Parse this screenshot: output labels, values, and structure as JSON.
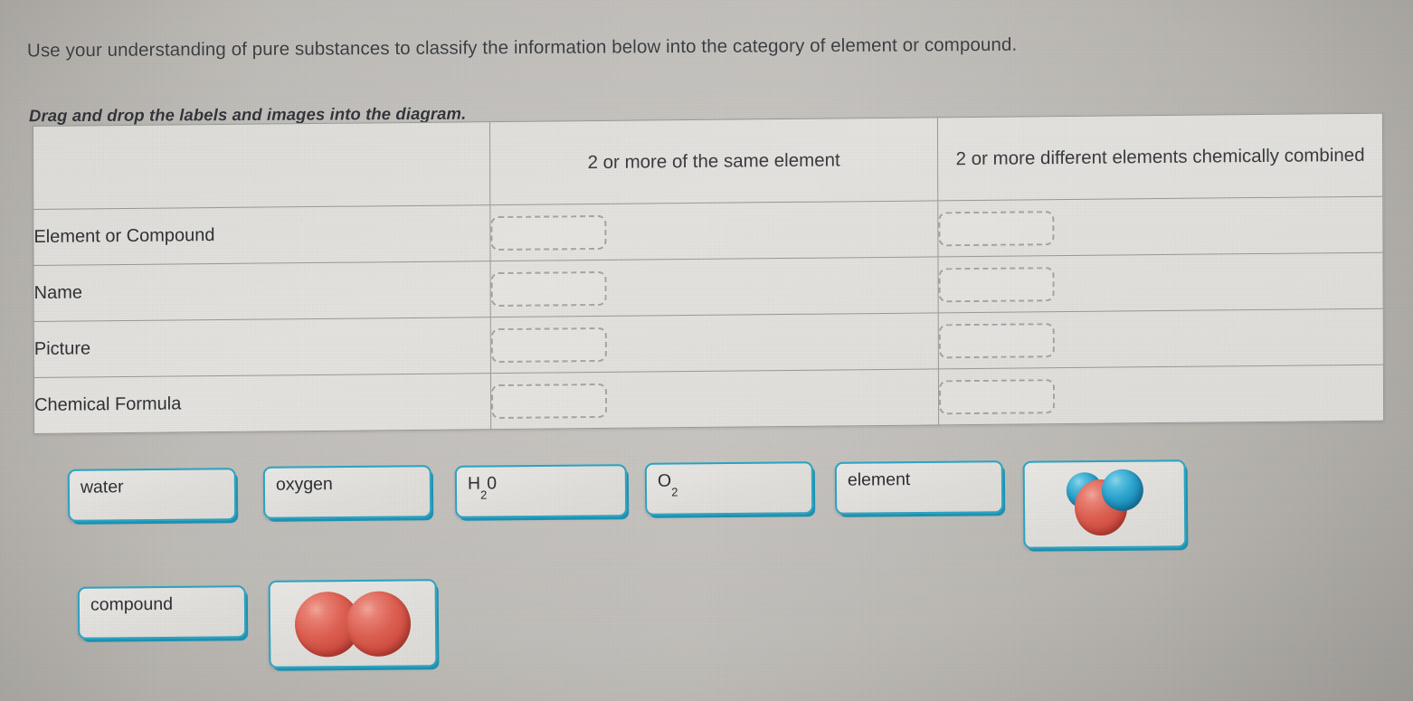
{
  "prompt": {
    "main": "Use your understanding of pure substances to classify the information below into the category of element or compound.",
    "instruction": "Drag and drop the labels and images into the diagram."
  },
  "table": {
    "headers": {
      "corner": "",
      "col_same": "2 or more of the same element",
      "col_diff": "2 or more different elements chemically combined"
    },
    "rows": [
      {
        "label": "Element or Compound",
        "same": "",
        "diff": ""
      },
      {
        "label": "Name",
        "same": "",
        "diff": ""
      },
      {
        "label": "Picture",
        "same": "",
        "diff": ""
      },
      {
        "label": "Chemical Formula",
        "same": "",
        "diff": ""
      }
    ]
  },
  "drag_items": [
    {
      "name": "water-chip",
      "type": "text",
      "label": "water"
    },
    {
      "name": "oxygen-chip",
      "type": "text",
      "label": "oxygen"
    },
    {
      "name": "h2o-formula-chip",
      "type": "text",
      "label_main": "H",
      "label_sub": "2",
      "label_tail": "0"
    },
    {
      "name": "o2-formula-chip",
      "type": "text",
      "label_main": "O",
      "label_sub": "2",
      "label_tail": ""
    },
    {
      "name": "element-chip",
      "type": "text",
      "label": "element"
    },
    {
      "name": "water-molecule-chip",
      "type": "image",
      "label": "water-molecule-image"
    },
    {
      "name": "compound-chip",
      "type": "text",
      "label": "compound"
    },
    {
      "name": "oxygen-molecule-chip",
      "type": "image",
      "label": "oxygen-molecule-image"
    }
  ],
  "colors": {
    "accent_teal": "#2ba6c6",
    "accent_teal_shadow": "#1d94b4",
    "oxygen_atom_red": "#e06253",
    "hydrogen_atom_blue": "#2aa4cf",
    "page_background": "#b5b2ad",
    "table_background": "#e2e0dc",
    "text": "#2f3136"
  }
}
